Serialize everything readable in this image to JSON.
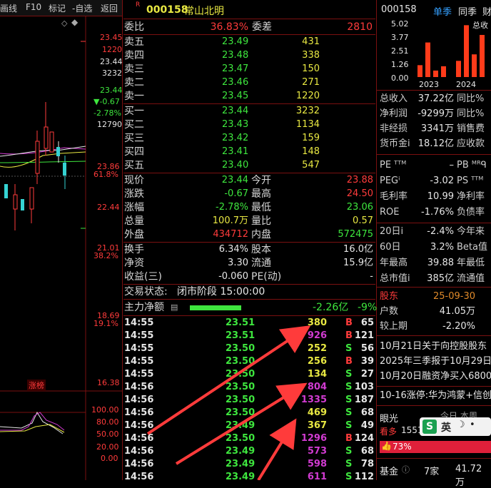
{
  "toolbar": {
    "items": [
      "画线",
      "F10",
      "标记",
      "-自选",
      "返回"
    ]
  },
  "kchart": {
    "price_labels": [
      "23.45",
      "1220",
      "23.44",
      "3232",
      "23.44",
      "▼-0.67",
      "-2.78%",
      "12790",
      "23.86",
      "61.8%",
      "22.44",
      "21.01",
      "38.2%",
      "18.69",
      "19.1%",
      "16.38"
    ],
    "badge": "涨榜",
    "osc_labels": [
      "100.00",
      "80.00",
      "50.00",
      "20.00",
      "0.00"
    ],
    "colors": {
      "up": "#ff3b3b",
      "down": "#35d3d3",
      "bg": "#000000",
      "grid": "#7a1010"
    }
  },
  "header": {
    "prefix": "R",
    "code": "000158",
    "name": "常山北明"
  },
  "ratio": {
    "label1": "委比",
    "value1": "36.83%",
    "label2": "委差",
    "value2": "2810"
  },
  "asks": [
    {
      "label": "卖五",
      "price": "23.49",
      "vol": "431"
    },
    {
      "label": "卖四",
      "price": "23.48",
      "vol": "338"
    },
    {
      "label": "卖三",
      "price": "23.47",
      "vol": "150"
    },
    {
      "label": "卖二",
      "price": "23.46",
      "vol": "271"
    },
    {
      "label": "卖一",
      "price": "23.45",
      "vol": "1220"
    }
  ],
  "bids": [
    {
      "label": "买一",
      "price": "23.44",
      "vol": "3232"
    },
    {
      "label": "买二",
      "price": "23.43",
      "vol": "1134"
    },
    {
      "label": "买三",
      "price": "23.42",
      "vol": "159"
    },
    {
      "label": "买四",
      "price": "23.41",
      "vol": "148"
    },
    {
      "label": "买五",
      "price": "23.40",
      "vol": "547"
    }
  ],
  "quote": [
    {
      "l1": "现价",
      "v1": "23.44",
      "c1": "green",
      "l2": "今开",
      "v2": "23.88",
      "c2": "red"
    },
    {
      "l1": "涨跌",
      "v1": "-0.67",
      "c1": "green",
      "l2": "最高",
      "v2": "24.50",
      "c2": "red"
    },
    {
      "l1": "涨幅",
      "v1": "-2.78%",
      "c1": "green",
      "l2": "最低",
      "v2": "23.06",
      "c2": "green"
    },
    {
      "l1": "总量",
      "v1": "100.7万",
      "c1": "yellow",
      "l2": "量比",
      "v2": "0.57",
      "c2": "yellow"
    },
    {
      "l1": "外盘",
      "v1": "434712",
      "c1": "red",
      "l2": "内盘",
      "v2": "572475",
      "c2": "green"
    }
  ],
  "stats": [
    {
      "l1": "换手",
      "v1": "6.34%",
      "l2": "股本",
      "v2": "16.0亿"
    },
    {
      "l1": "净资",
      "v1": "3.30",
      "l2": "流通",
      "v2": "15.9亿"
    },
    {
      "l1": "收益(三)",
      "v1": "-0.060",
      "l2": "PE(动)",
      "v2": "-"
    }
  ],
  "trade_status": {
    "label": "交易状态:",
    "value": "闭市阶段 15:00:00"
  },
  "main_flow": {
    "label": "主力净额",
    "value": "-2.26亿",
    "pct": "-9%",
    "bar_fraction": 0.6
  },
  "ticks": [
    {
      "t": "14:55",
      "p": "23.51",
      "v": "380",
      "vc": "yellow",
      "d": "B",
      "n": "65"
    },
    {
      "t": "14:55",
      "p": "23.51",
      "v": "926",
      "vc": "magenta",
      "d": "B",
      "n": "121"
    },
    {
      "t": "14:55",
      "p": "23.50",
      "v": "252",
      "vc": "yellow",
      "d": "S",
      "n": "56"
    },
    {
      "t": "14:55",
      "p": "23.50",
      "v": "256",
      "vc": "yellow",
      "d": "B",
      "n": "39"
    },
    {
      "t": "14:55",
      "p": "23.50",
      "v": "134",
      "vc": "yellow",
      "d": "S",
      "n": "27"
    },
    {
      "t": "14:56",
      "p": "23.50",
      "v": "804",
      "vc": "magenta",
      "d": "S",
      "n": "103"
    },
    {
      "t": "14:56",
      "p": "23.50",
      "v": "1335",
      "vc": "magenta",
      "d": "S",
      "n": "187"
    },
    {
      "t": "14:56",
      "p": "23.50",
      "v": "469",
      "vc": "yellow",
      "d": "S",
      "n": "68"
    },
    {
      "t": "14:56",
      "p": "23.49",
      "v": "367",
      "vc": "yellow",
      "d": "S",
      "n": "49"
    },
    {
      "t": "14:56",
      "p": "23.50",
      "v": "1296",
      "vc": "magenta",
      "d": "B",
      "n": "124"
    },
    {
      "t": "14:56",
      "p": "23.49",
      "v": "573",
      "vc": "magenta",
      "d": "S",
      "n": "68"
    },
    {
      "t": "14:56",
      "p": "23.49",
      "v": "598",
      "vc": "magenta",
      "d": "S",
      "n": "78"
    },
    {
      "t": "14:56",
      "p": "23.49",
      "v": "611",
      "vc": "magenta",
      "d": "S",
      "n": "112"
    }
  ],
  "right": {
    "code": "000158",
    "tabs": [
      "单季",
      "同季",
      "财"
    ],
    "mini_title": "总收",
    "mini_y": [
      "5.02",
      "3.77",
      "2.51",
      "1.26",
      "0.00"
    ],
    "mini_years": [
      "2023",
      "2024"
    ],
    "mini_values": [
      1.1,
      3.2,
      0.6,
      1.0,
      1.5,
      4.8,
      2.1,
      3.9
    ],
    "fin": [
      {
        "l": "总收入",
        "v": "37.22亿",
        "l2": "同比%"
      },
      {
        "l": "净利润",
        "v": "-9299万",
        "l2": "同比%"
      },
      {
        "l": "非经损",
        "v": "3341万",
        "l2": "销售费"
      },
      {
        "l": "货币金i",
        "v": "18.12亿",
        "l2": "应收款"
      }
    ],
    "val1": [
      {
        "l": "PE ᵀᵀᴹ",
        "v": "–",
        "l2": "PB ᴹᴿᑫ"
      },
      {
        "l": "PEGⁱ",
        "v": "-3.02",
        "l2": "PS ᵀᵀᴹ"
      },
      {
        "l": "毛利率",
        "v": "10.99",
        "l2": "净利率"
      },
      {
        "l": "ROE",
        "v": "-1.76%",
        "l2": "负债率"
      }
    ],
    "val2": [
      {
        "l": "20日i",
        "v": "-2.4%",
        "l2": "今年来"
      },
      {
        "l": "60日",
        "v": "3.2%",
        "l2": "Beta值"
      },
      {
        "l": "年最高",
        "v": "39.88",
        "l2": "年最低"
      },
      {
        "l": "总市值i",
        "v": "385亿",
        "l2": "流通值"
      }
    ],
    "holders": [
      {
        "l": "股东",
        "v": "25-09-30"
      },
      {
        "l": "户数",
        "v": "41.05万"
      },
      {
        "l": "较上期",
        "v": "-2.20%"
      }
    ],
    "news": [
      "10月21日关于向控股股东",
      "2025年三季报于10月29日",
      "10月20日融资净买入6800"
    ],
    "news2": "10-16涨停:华为鸿蒙+信创",
    "eye": {
      "label": "眼光",
      "v": "1551",
      "today": "今日 本周",
      "bull": "看多",
      "ime": "英"
    },
    "bull_pct": "73%",
    "fund": {
      "l": "基金",
      "v": "7家",
      "v2": "41.72万"
    }
  }
}
